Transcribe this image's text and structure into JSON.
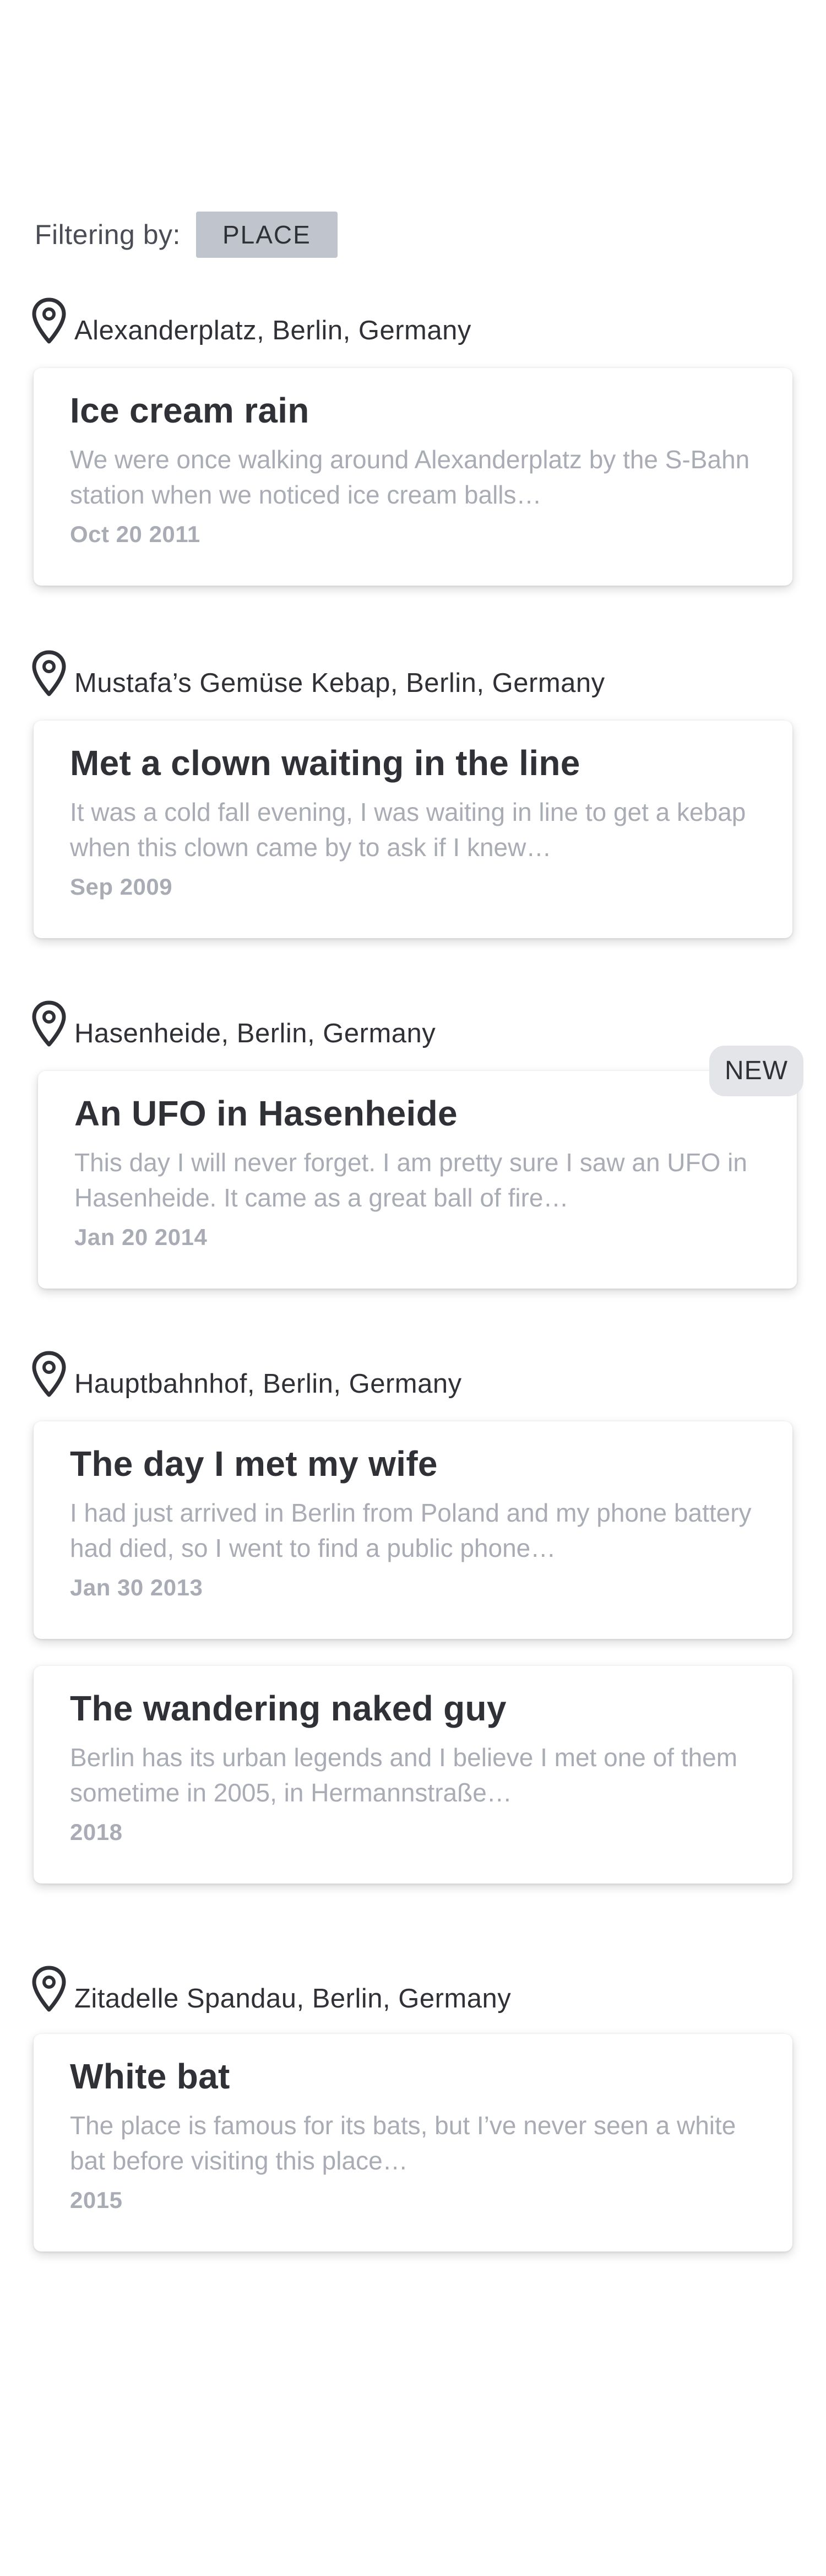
{
  "filter": {
    "label": "Filtering by:",
    "value": "PLACE"
  },
  "groups": [
    {
      "location": "Alexanderplatz, Berlin, Germany",
      "stories": [
        {
          "title": "Ice cream rain",
          "excerpt": "We were once walking around Alexanderplatz by the S-Bahn station when we noticed ice cream balls…",
          "date": "Oct 20 2011"
        }
      ]
    },
    {
      "location": "Mustafa’s Gemüse Kebap, Berlin, Germany",
      "stories": [
        {
          "title": "Met a clown waiting in the line",
          "excerpt": "It was a cold fall evening, I was waiting in line to get a kebap when this clown came by to ask if I knew…",
          "date": "Sep 2009"
        }
      ]
    },
    {
      "location": "Hasenheide, Berlin, Germany",
      "stories": [
        {
          "title": "An UFO in Hasenheide",
          "excerpt": "This day I will never forget. I am pretty sure I saw an UFO in Hasenheide. It came as a great ball of fire…",
          "date": "Jan 20 2014",
          "badge": "NEW"
        }
      ]
    },
    {
      "location": "Hauptbahnhof, Berlin, Germany",
      "stories": [
        {
          "title": "The day I met my wife",
          "excerpt": "I had just arrived in Berlin from Poland and my phone battery had died, so I went to find a public phone…",
          "date": "Jan 30 2013"
        },
        {
          "title": "The wandering naked guy",
          "excerpt": "Berlin has its urban legends and I believe I met one of them sometime in 2005, in Hermannstraße…",
          "date": "2018"
        }
      ]
    },
    {
      "location": "Zitadelle Spandau, Berlin, Germany",
      "stories": [
        {
          "title": "White bat",
          "excerpt": "The place is famous for its bats, but I’ve never seen a white bat before visiting this place…",
          "date": "2015"
        }
      ]
    }
  ],
  "icons": {
    "location": "map-pin-icon"
  }
}
